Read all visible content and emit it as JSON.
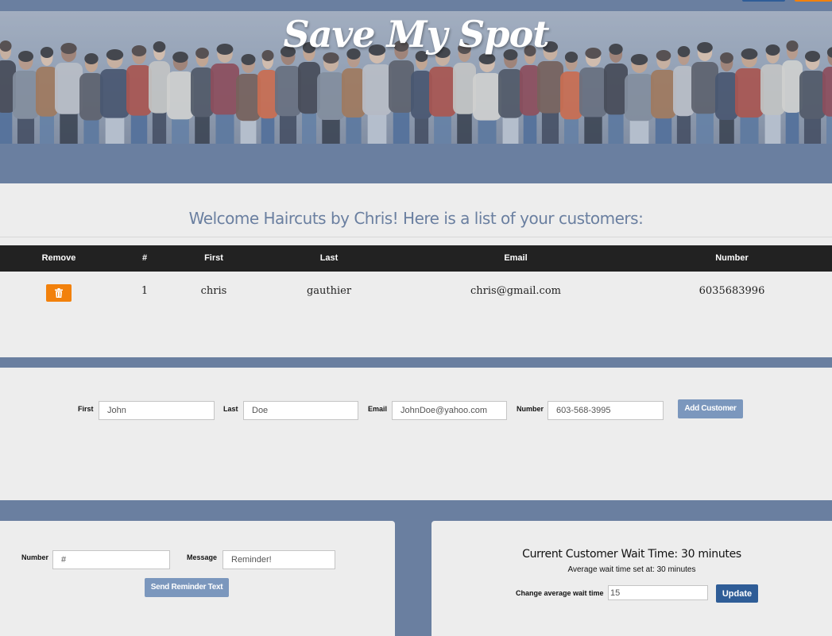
{
  "header": {
    "title": "Save My Spot"
  },
  "customers": {
    "welcome": "Welcome Haircuts by Chris! Here is a list of your customers:",
    "columns": [
      "Remove",
      "#",
      "First",
      "Last",
      "Email",
      "Number"
    ],
    "rows": [
      {
        "num": "1",
        "first": "chris",
        "last": "gauthier",
        "email": "chris@gmail.com",
        "number": "6035683996"
      }
    ]
  },
  "add_form": {
    "first_label": "First",
    "first_placeholder": "John",
    "last_label": "Last",
    "last_placeholder": "Doe",
    "email_label": "Email",
    "email_placeholder": "JohnDoe@yahoo.com",
    "number_label": "Number",
    "number_placeholder": "603-568-3995",
    "submit": "Add Customer"
  },
  "reminder": {
    "number_label": "Number",
    "number_placeholder": "#",
    "message_label": "Message",
    "message_placeholder": "Reminder!",
    "submit": "Send Reminder Text"
  },
  "wait": {
    "title": "Current Customer Wait Time: 30 minutes",
    "subtitle": "Average wait time set at: 30 minutes",
    "change_label": "Change average wait time",
    "input_placeholder": "15",
    "submit": "Update"
  },
  "icons": {
    "remove": "trash-icon"
  },
  "colors": {
    "band": "#6a7fa0",
    "accent_orange": "#f2810c",
    "button_steel": "#7b97bd",
    "button_blue": "#2f5d97"
  }
}
